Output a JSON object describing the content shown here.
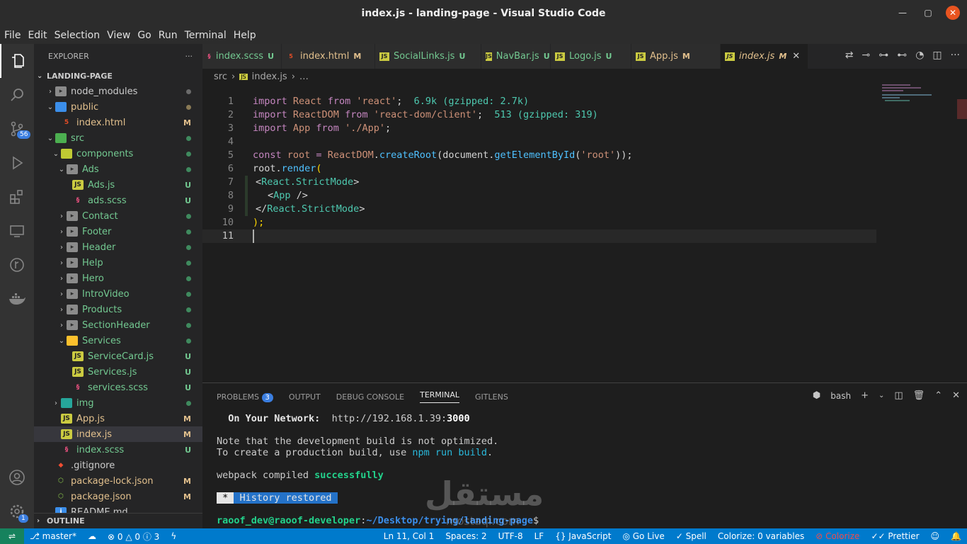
{
  "window": {
    "title": "index.js - landing-page - Visual Studio Code"
  },
  "menu": [
    "File",
    "Edit",
    "Selection",
    "View",
    "Go",
    "Run",
    "Terminal",
    "Help"
  ],
  "activity": {
    "source_control_badge": "56",
    "accounts_badge": "1"
  },
  "explorer": {
    "header": "EXPLORER",
    "more": "···",
    "project": "LANDING-PAGE",
    "outline": "OUTLINE",
    "items": [
      {
        "depth": 0,
        "chev": "›",
        "icon": "folder",
        "label": "node_modules",
        "status": "dot",
        "color": "#cccccc"
      },
      {
        "depth": 0,
        "chev": "⌄",
        "icon": "folder-public",
        "label": "public",
        "status": "dot",
        "color": "#e2c08d"
      },
      {
        "depth": 1,
        "chev": "",
        "icon": "html",
        "label": "index.html",
        "status": "M",
        "color": "#e2c08d"
      },
      {
        "depth": 0,
        "chev": "⌄",
        "icon": "folder-src",
        "label": "src",
        "status": "dot",
        "color": "#73c991"
      },
      {
        "depth": 1,
        "chev": "⌄",
        "icon": "folder-components",
        "label": "components",
        "status": "dot",
        "color": "#73c991"
      },
      {
        "depth": 2,
        "chev": "⌄",
        "icon": "folder",
        "label": "Ads",
        "status": "dot",
        "color": "#73c991"
      },
      {
        "depth": 3,
        "chev": "",
        "icon": "js",
        "label": "Ads.js",
        "status": "U",
        "color": "#73c991"
      },
      {
        "depth": 3,
        "chev": "",
        "icon": "scss",
        "label": "ads.scss",
        "status": "U",
        "color": "#73c991"
      },
      {
        "depth": 2,
        "chev": "›",
        "icon": "folder",
        "label": "Contact",
        "status": "dot",
        "color": "#73c991"
      },
      {
        "depth": 2,
        "chev": "›",
        "icon": "folder",
        "label": "Footer",
        "status": "dot",
        "color": "#73c991"
      },
      {
        "depth": 2,
        "chev": "›",
        "icon": "folder",
        "label": "Header",
        "status": "dot",
        "color": "#73c991"
      },
      {
        "depth": 2,
        "chev": "›",
        "icon": "folder",
        "label": "Help",
        "status": "dot",
        "color": "#73c991"
      },
      {
        "depth": 2,
        "chev": "›",
        "icon": "folder",
        "label": "Hero",
        "status": "dot",
        "color": "#73c991"
      },
      {
        "depth": 2,
        "chev": "›",
        "icon": "folder",
        "label": "IntroVideo",
        "status": "dot",
        "color": "#73c991"
      },
      {
        "depth": 2,
        "chev": "›",
        "icon": "folder",
        "label": "Products",
        "status": "dot",
        "color": "#73c991"
      },
      {
        "depth": 2,
        "chev": "›",
        "icon": "folder",
        "label": "SectionHeader",
        "status": "dot",
        "color": "#73c991"
      },
      {
        "depth": 2,
        "chev": "⌄",
        "icon": "folder-services",
        "label": "Services",
        "status": "dot",
        "color": "#73c991"
      },
      {
        "depth": 3,
        "chev": "",
        "icon": "js",
        "label": "ServiceCard.js",
        "status": "U",
        "color": "#73c991"
      },
      {
        "depth": 3,
        "chev": "",
        "icon": "js",
        "label": "Services.js",
        "status": "U",
        "color": "#73c991"
      },
      {
        "depth": 3,
        "chev": "",
        "icon": "scss",
        "label": "services.scss",
        "status": "U",
        "color": "#73c991"
      },
      {
        "depth": 1,
        "chev": "›",
        "icon": "folder-img",
        "label": "img",
        "status": "dot",
        "color": "#73c991"
      },
      {
        "depth": 1,
        "chev": "",
        "icon": "js",
        "label": "App.js",
        "status": "M",
        "color": "#e2c08d"
      },
      {
        "depth": 1,
        "chev": "",
        "icon": "js",
        "label": "index.js",
        "status": "M",
        "color": "#e2c08d",
        "selected": true
      },
      {
        "depth": 1,
        "chev": "",
        "icon": "scss",
        "label": "index.scss",
        "status": "U",
        "color": "#73c991"
      },
      {
        "depth": 0,
        "chev": "",
        "icon": "git",
        "label": ".gitignore",
        "status": "",
        "color": "#cccccc"
      },
      {
        "depth": 0,
        "chev": "",
        "icon": "node",
        "label": "package-lock.json",
        "status": "M",
        "color": "#e2c08d"
      },
      {
        "depth": 0,
        "chev": "",
        "icon": "node",
        "label": "package.json",
        "status": "M",
        "color": "#e2c08d"
      },
      {
        "depth": 0,
        "chev": "",
        "icon": "info",
        "label": "README.md",
        "status": "",
        "color": "#cccccc"
      }
    ]
  },
  "tabs": [
    {
      "label": "index.scss",
      "icon": "scss",
      "status": "U",
      "color": "#73c991"
    },
    {
      "label": "index.html",
      "icon": "html",
      "status": "M",
      "color": "#e2c08d"
    },
    {
      "label": "SocialLinks.js",
      "icon": "js",
      "status": "U",
      "color": "#73c991"
    },
    {
      "label": "NavBar.js",
      "icon": "js",
      "status": "U",
      "color": "#73c991"
    },
    {
      "label": "Logo.js",
      "icon": "js",
      "status": "U",
      "color": "#73c991"
    },
    {
      "label": "App.js",
      "icon": "js",
      "status": "M",
      "color": "#e2c08d"
    },
    {
      "label": "index.js",
      "icon": "js",
      "status": "M",
      "color": "#e2c08d",
      "active": true
    }
  ],
  "breadcrumb": {
    "folder": "src",
    "sep": "›",
    "file": "index.js",
    "more": "…"
  },
  "code": {
    "l1": {
      "n": "1",
      "a": "import",
      "b": " React ",
      "c": "from",
      "d": " 'react'",
      "e": ";  ",
      "f": "6.9k (gzipped: 2.7k)"
    },
    "l2": {
      "n": "2",
      "a": "import",
      "b": " ReactDOM ",
      "c": "from",
      "d": " 'react-dom/client'",
      "e": ";  ",
      "f": "513 (gzipped: 319)"
    },
    "l3": {
      "n": "3",
      "a": "import",
      "b": " App ",
      "c": "from",
      "d": " './App'",
      "e": ";"
    },
    "l4": {
      "n": "4"
    },
    "l5": {
      "n": "5",
      "a": "const",
      "b": " root ",
      "c": "=",
      "d": " ReactDOM",
      "e": ".",
      "f": "createRoot",
      "g": "(document.",
      "h": "getElementById",
      "i": "(",
      "j": "'root'",
      "k": "));"
    },
    "l6": {
      "n": "6",
      "a": "root.",
      "b": "render",
      "c": "("
    },
    "l7": {
      "n": "7",
      "a": "<",
      "b": "React.StrictMode",
      "c": ">"
    },
    "l8": {
      "n": "8",
      "a": "<",
      "b": "App",
      "c": " />"
    },
    "l9": {
      "n": "9",
      "a": "</",
      "b": "React.StrictMode",
      "c": ">"
    },
    "l10": {
      "n": "10",
      "a": ");"
    },
    "l11": {
      "n": "11"
    }
  },
  "panel": {
    "tabs": [
      "PROBLEMS",
      "OUTPUT",
      "DEBUG CONSOLE",
      "TERMINAL",
      "GITLENS"
    ],
    "problems_count": "3",
    "shell": "bash",
    "terminal": {
      "net_label": "  On Your Network:",
      "net_url": "  http://192.168.1.39:",
      "net_port": "3000",
      "note1": "Note that the development build is not optimized.",
      "note2a": "To create a production build, use ",
      "note2b": "npm run build",
      "note2c": ".",
      "compiled_a": "webpack compiled ",
      "compiled_b": "successfully",
      "history_star": " * ",
      "history": " History restored ",
      "prompt_user": "raoof_dev@raoof-developer",
      "prompt_colon": ":",
      "prompt_path": "~/Desktop/trying/landing-page",
      "prompt_dollar": "$"
    }
  },
  "status": {
    "branch": "master*",
    "errors": "0",
    "warnings": "0",
    "info": "3",
    "position": "Ln 11, Col 1",
    "spaces": "Spaces: 2",
    "encoding": "UTF-8",
    "eol": "LF",
    "language": "JavaScript",
    "golive": "Go Live",
    "spell": "Spell",
    "colorize_vars": "Colorize: 0 variables",
    "colorize": "Colorize",
    "prettier": "Prettier"
  },
  "watermark": {
    "ar": "مستقل",
    "en": "mostaql.com"
  }
}
